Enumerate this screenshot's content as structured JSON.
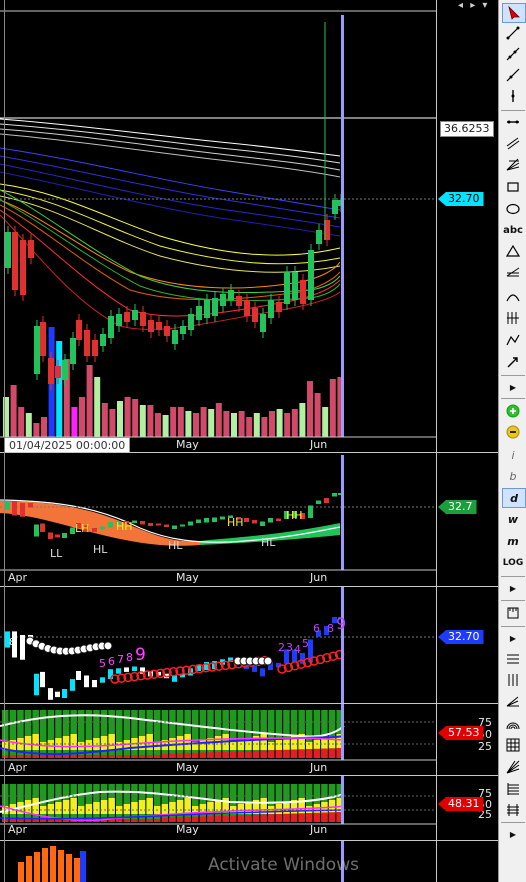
{
  "chart": {
    "price_tag_last": "32.70",
    "price_tag_upper": "36.6253",
    "date_tooltip": "01/04/2025 00:00:00",
    "months_main": [
      "May",
      "Jun"
    ],
    "months_sub": [
      "Apr",
      "May",
      "Jun"
    ],
    "ema_panel_tag": "32.7",
    "pivot_labels": [
      "LH",
      "HH",
      "LL",
      "HL",
      "HL",
      "HH",
      "HH",
      "HL"
    ],
    "td_panel_tag": "32.70",
    "td_counts_red": [
      "5",
      "6",
      "7",
      "8",
      "9"
    ],
    "td_counts_purple": [
      "2",
      "3",
      "4",
      "5",
      "6",
      "8",
      "9"
    ],
    "td_first_count": "8",
    "osc1_tag": "57.53",
    "osc2_tag": "48.31",
    "levels": [
      "75",
      "50",
      "25"
    ],
    "colors": {
      "cyan": "#00e5ff",
      "green_tag": "#1aa03a",
      "blue_tag": "#1e3cff",
      "red_tag": "#e00000",
      "bull_candle": "#22c35a",
      "bear_candle": "#e03030",
      "cursor_line": "#9b9bff"
    }
  },
  "toolbar": {
    "tools": [
      "pointer",
      "line",
      "ray",
      "extended-line",
      "vertical-line",
      "horizontal-line",
      "channel",
      "fib-fan",
      "rectangle",
      "ellipse",
      "text",
      "triangle",
      "fibonacci",
      "arc",
      "fib-time",
      "polyline",
      "arrow"
    ],
    "text_tool_label": "abc",
    "letter_tools": [
      "i",
      "b",
      "d",
      "w",
      "m",
      "LOG"
    ]
  },
  "watermark": "Activate Windows"
}
